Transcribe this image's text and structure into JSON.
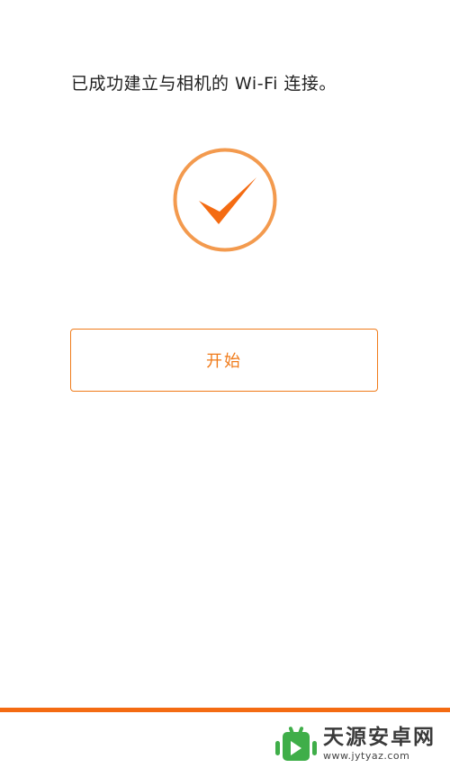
{
  "status": {
    "message": "已成功建立与相机的 Wi-Fi 连接。",
    "icon": "checkmark-circle-icon"
  },
  "actions": {
    "start_label": "开始"
  },
  "colors": {
    "accent": "#f07b1a",
    "circle": "#f39a4e",
    "bar": "#f46b12",
    "watermark_green": "#3fae49"
  },
  "watermark": {
    "logo": "android-robot-icon",
    "title": "天源安卓网",
    "url": "www.jytyaz.com"
  }
}
